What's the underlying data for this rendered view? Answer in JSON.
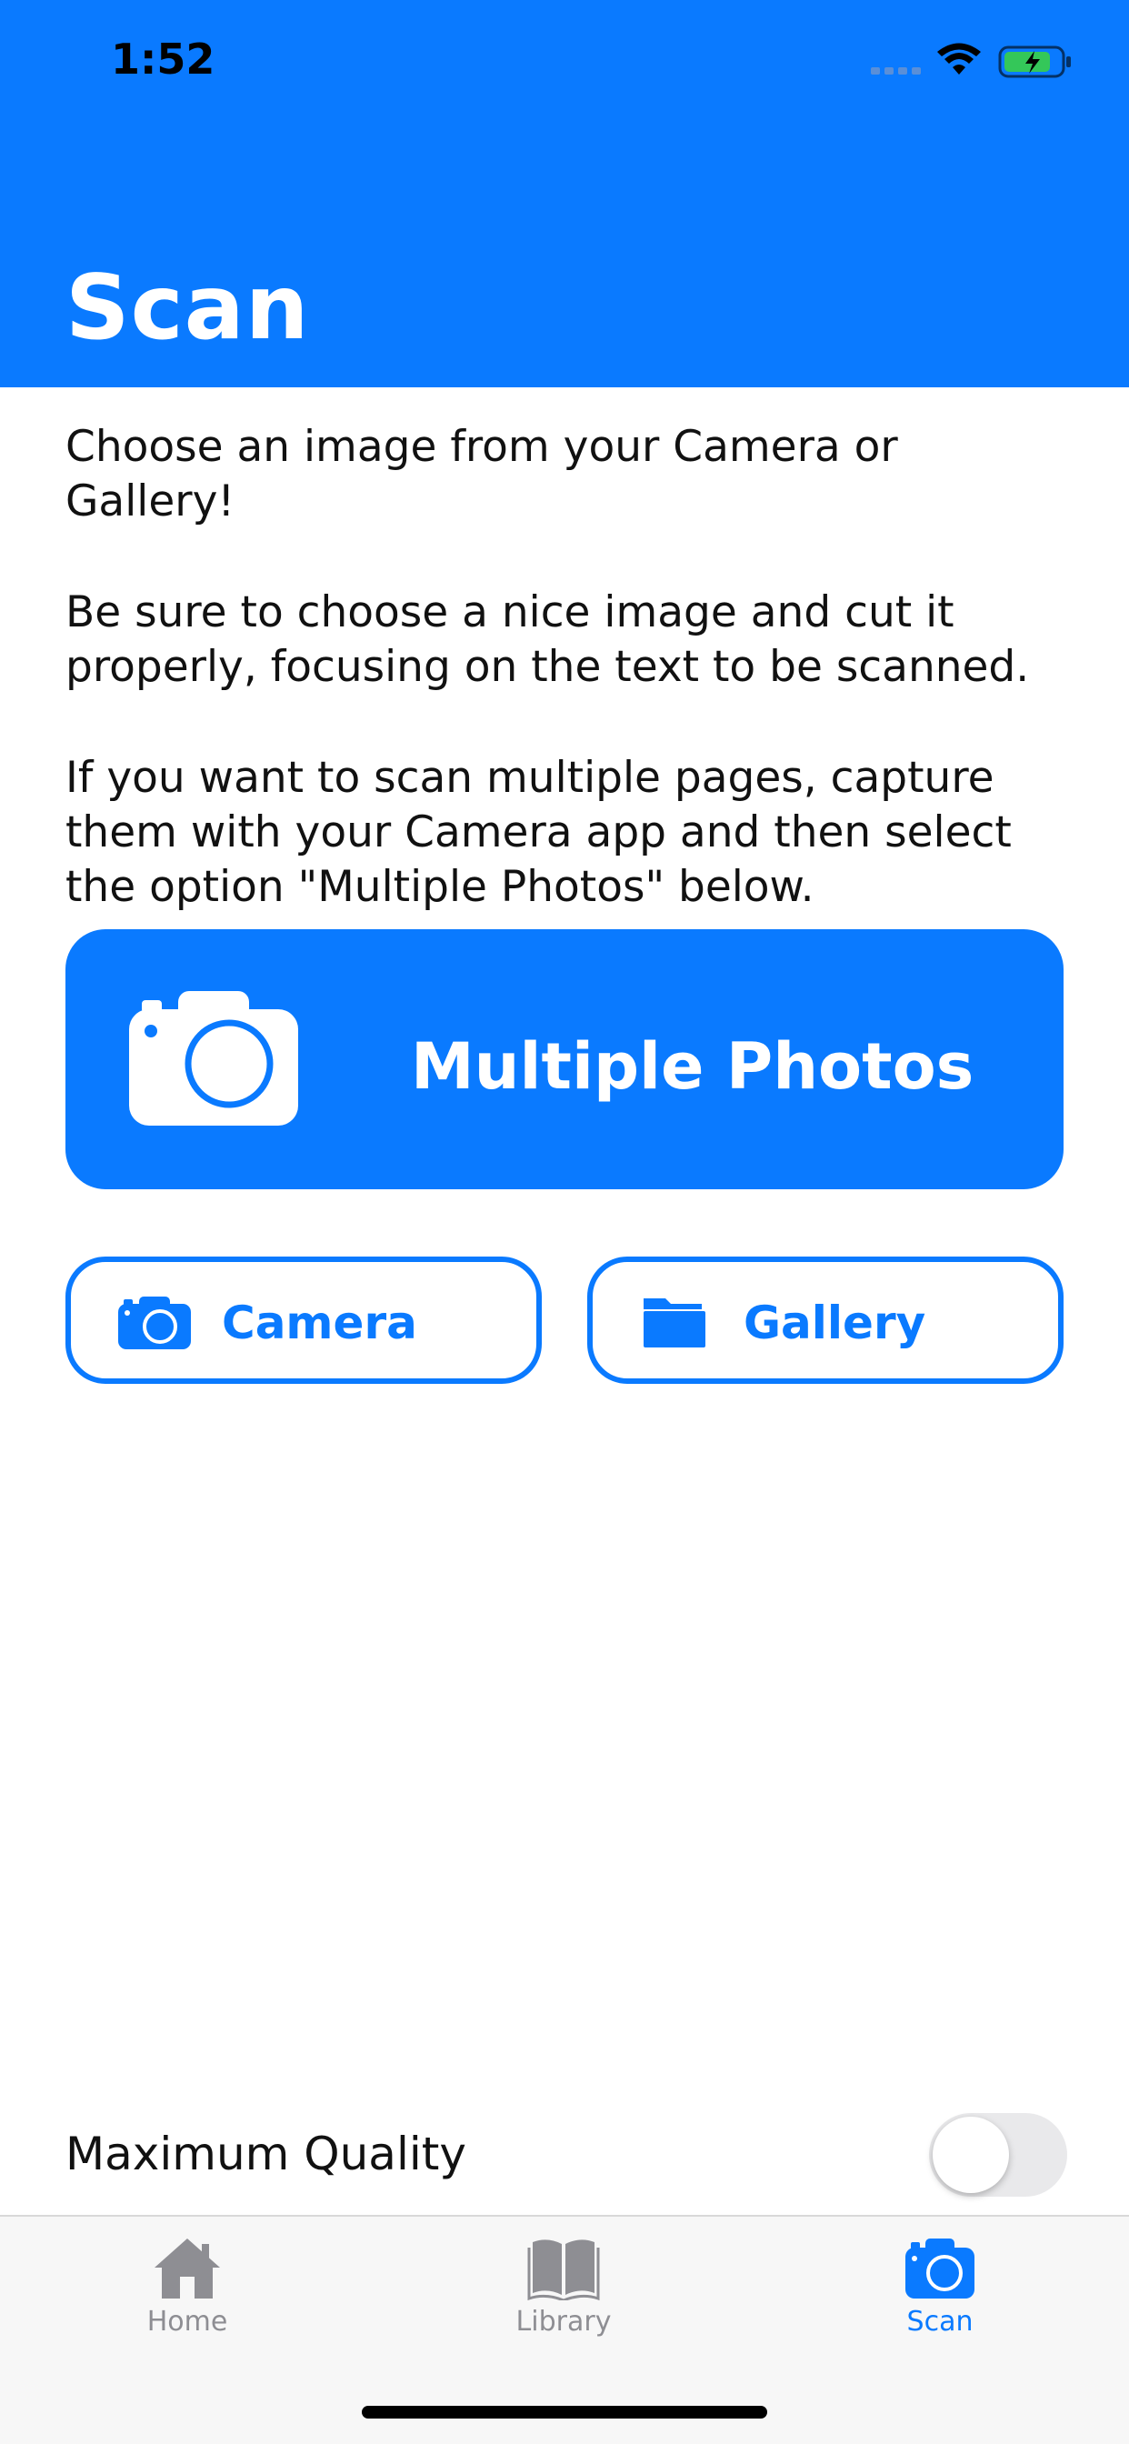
{
  "status_bar": {
    "time": "1:52"
  },
  "header": {
    "title": "Scan"
  },
  "intro": {
    "paragraphs": [
      "Choose an image from your Camera or Gallery!",
      "Be sure to choose a nice image and cut it properly, focusing on the text to be scanned.",
      "If you want to scan multiple pages, capture them with your Camera app and then select the option \"Multiple Photos\" below."
    ]
  },
  "actions": {
    "multiple_photos": {
      "label": "Multiple Photos",
      "icon": "camera-icon"
    },
    "camera": {
      "label": "Camera",
      "icon": "camera-icon"
    },
    "gallery": {
      "label": "Gallery",
      "icon": "folder-icon"
    }
  },
  "settings": {
    "maximum_quality": {
      "label": "Maximum Quality",
      "enabled": false
    }
  },
  "tab_bar": {
    "tabs": [
      {
        "label": "Home",
        "icon": "home-icon",
        "active": false
      },
      {
        "label": "Library",
        "icon": "book-icon",
        "active": false
      },
      {
        "label": "Scan",
        "icon": "camera-icon",
        "active": true
      }
    ]
  },
  "colors": {
    "accent": "#0A7AFF",
    "inactive_tab": "#8E8E93"
  }
}
